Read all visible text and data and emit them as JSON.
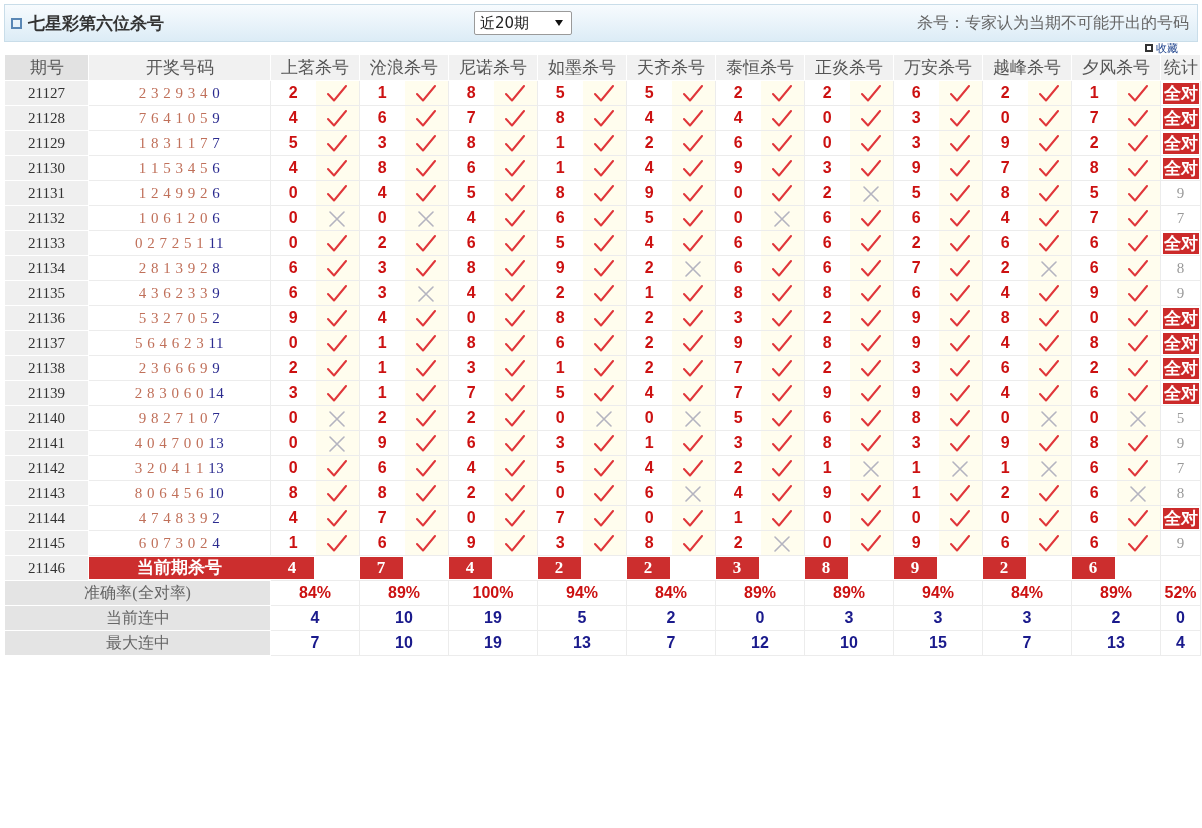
{
  "title": "七星彩第六位杀号",
  "period_select": {
    "value": "近20期"
  },
  "hint": "杀号：专家认为当期不可能开出的号码",
  "favorite": {
    "label": "收藏"
  },
  "columns": [
    "期号",
    "开奖号码",
    "上茗杀号",
    "沧浪杀号",
    "尼诺杀号",
    "如墨杀号",
    "天齐杀号",
    "泰恒杀号",
    "正炎杀号",
    "万安杀号",
    "越峰杀号",
    "夕风杀号",
    "统计"
  ],
  "rows": [
    {
      "issue": "21127",
      "main": "2 3 2 9 3 4",
      "special": "0",
      "kills": [
        {
          "num": "2",
          "hit": true
        },
        {
          "num": "1",
          "hit": true
        },
        {
          "num": "8",
          "hit": true
        },
        {
          "num": "5",
          "hit": true
        },
        {
          "num": "5",
          "hit": true
        },
        {
          "num": "2",
          "hit": true
        },
        {
          "num": "2",
          "hit": true
        },
        {
          "num": "6",
          "hit": true
        },
        {
          "num": "2",
          "hit": true
        },
        {
          "num": "1",
          "hit": true
        }
      ],
      "stat": {
        "kind": "badge",
        "text": "全对"
      }
    },
    {
      "issue": "21128",
      "main": "7 6 4 1 0 5",
      "special": "9",
      "kills": [
        {
          "num": "4",
          "hit": true
        },
        {
          "num": "6",
          "hit": true
        },
        {
          "num": "7",
          "hit": true
        },
        {
          "num": "8",
          "hit": true
        },
        {
          "num": "4",
          "hit": true
        },
        {
          "num": "4",
          "hit": true
        },
        {
          "num": "0",
          "hit": true
        },
        {
          "num": "3",
          "hit": true
        },
        {
          "num": "0",
          "hit": true
        },
        {
          "num": "7",
          "hit": true
        }
      ],
      "stat": {
        "kind": "badge",
        "text": "全对"
      }
    },
    {
      "issue": "21129",
      "main": "1 8 3 1 1 7",
      "special": "7",
      "kills": [
        {
          "num": "5",
          "hit": true
        },
        {
          "num": "3",
          "hit": true
        },
        {
          "num": "8",
          "hit": true
        },
        {
          "num": "1",
          "hit": true
        },
        {
          "num": "2",
          "hit": true
        },
        {
          "num": "6",
          "hit": true
        },
        {
          "num": "0",
          "hit": true
        },
        {
          "num": "3",
          "hit": true
        },
        {
          "num": "9",
          "hit": true
        },
        {
          "num": "2",
          "hit": true
        }
      ],
      "stat": {
        "kind": "badge",
        "text": "全对"
      }
    },
    {
      "issue": "21130",
      "main": "1 1 5 3 4 5",
      "special": "6",
      "kills": [
        {
          "num": "4",
          "hit": true
        },
        {
          "num": "8",
          "hit": true
        },
        {
          "num": "6",
          "hit": true
        },
        {
          "num": "1",
          "hit": true
        },
        {
          "num": "4",
          "hit": true
        },
        {
          "num": "9",
          "hit": true
        },
        {
          "num": "3",
          "hit": true
        },
        {
          "num": "9",
          "hit": true
        },
        {
          "num": "7",
          "hit": true
        },
        {
          "num": "8",
          "hit": true
        }
      ],
      "stat": {
        "kind": "badge",
        "text": "全对"
      }
    },
    {
      "issue": "21131",
      "main": "1 2 4 9 9 2",
      "special": "6",
      "kills": [
        {
          "num": "0",
          "hit": true
        },
        {
          "num": "4",
          "hit": true
        },
        {
          "num": "5",
          "hit": true
        },
        {
          "num": "8",
          "hit": true
        },
        {
          "num": "9",
          "hit": true
        },
        {
          "num": "0",
          "hit": true
        },
        {
          "num": "2",
          "hit": false
        },
        {
          "num": "5",
          "hit": true
        },
        {
          "num": "8",
          "hit": true
        },
        {
          "num": "5",
          "hit": true
        }
      ],
      "stat": {
        "kind": "count",
        "text": "9"
      }
    },
    {
      "issue": "21132",
      "main": "1 0 6 1 2 0",
      "special": "6",
      "kills": [
        {
          "num": "0",
          "hit": false
        },
        {
          "num": "0",
          "hit": false
        },
        {
          "num": "4",
          "hit": true
        },
        {
          "num": "6",
          "hit": true
        },
        {
          "num": "5",
          "hit": true
        },
        {
          "num": "0",
          "hit": false
        },
        {
          "num": "6",
          "hit": true
        },
        {
          "num": "6",
          "hit": true
        },
        {
          "num": "4",
          "hit": true
        },
        {
          "num": "7",
          "hit": true
        }
      ],
      "stat": {
        "kind": "count",
        "text": "7"
      }
    },
    {
      "issue": "21133",
      "main": "0 2 7 2 5 1",
      "special": "11",
      "kills": [
        {
          "num": "0",
          "hit": true
        },
        {
          "num": "2",
          "hit": true
        },
        {
          "num": "6",
          "hit": true
        },
        {
          "num": "5",
          "hit": true
        },
        {
          "num": "4",
          "hit": true
        },
        {
          "num": "6",
          "hit": true
        },
        {
          "num": "6",
          "hit": true
        },
        {
          "num": "2",
          "hit": true
        },
        {
          "num": "6",
          "hit": true
        },
        {
          "num": "6",
          "hit": true
        }
      ],
      "stat": {
        "kind": "badge",
        "text": "全对"
      }
    },
    {
      "issue": "21134",
      "main": "2 8 1 3 9 2",
      "special": "8",
      "kills": [
        {
          "num": "6",
          "hit": true
        },
        {
          "num": "3",
          "hit": true
        },
        {
          "num": "8",
          "hit": true
        },
        {
          "num": "9",
          "hit": true
        },
        {
          "num": "2",
          "hit": false
        },
        {
          "num": "6",
          "hit": true
        },
        {
          "num": "6",
          "hit": true
        },
        {
          "num": "7",
          "hit": true
        },
        {
          "num": "2",
          "hit": false
        },
        {
          "num": "6",
          "hit": true
        }
      ],
      "stat": {
        "kind": "count",
        "text": "8"
      }
    },
    {
      "issue": "21135",
      "main": "4 3 6 2 3 3",
      "special": "9",
      "kills": [
        {
          "num": "6",
          "hit": true
        },
        {
          "num": "3",
          "hit": false
        },
        {
          "num": "4",
          "hit": true
        },
        {
          "num": "2",
          "hit": true
        },
        {
          "num": "1",
          "hit": true
        },
        {
          "num": "8",
          "hit": true
        },
        {
          "num": "8",
          "hit": true
        },
        {
          "num": "6",
          "hit": true
        },
        {
          "num": "4",
          "hit": true
        },
        {
          "num": "9",
          "hit": true
        }
      ],
      "stat": {
        "kind": "count",
        "text": "9"
      }
    },
    {
      "issue": "21136",
      "main": "5 3 2 7 0 5",
      "special": "2",
      "kills": [
        {
          "num": "9",
          "hit": true
        },
        {
          "num": "4",
          "hit": true
        },
        {
          "num": "0",
          "hit": true
        },
        {
          "num": "8",
          "hit": true
        },
        {
          "num": "2",
          "hit": true
        },
        {
          "num": "3",
          "hit": true
        },
        {
          "num": "2",
          "hit": true
        },
        {
          "num": "9",
          "hit": true
        },
        {
          "num": "8",
          "hit": true
        },
        {
          "num": "0",
          "hit": true
        }
      ],
      "stat": {
        "kind": "badge",
        "text": "全对"
      }
    },
    {
      "issue": "21137",
      "main": "5 6 4 6 2 3",
      "special": "11",
      "kills": [
        {
          "num": "0",
          "hit": true
        },
        {
          "num": "1",
          "hit": true
        },
        {
          "num": "8",
          "hit": true
        },
        {
          "num": "6",
          "hit": true
        },
        {
          "num": "2",
          "hit": true
        },
        {
          "num": "9",
          "hit": true
        },
        {
          "num": "8",
          "hit": true
        },
        {
          "num": "9",
          "hit": true
        },
        {
          "num": "4",
          "hit": true
        },
        {
          "num": "8",
          "hit": true
        }
      ],
      "stat": {
        "kind": "badge",
        "text": "全对"
      }
    },
    {
      "issue": "21138",
      "main": "2 3 6 6 6 9",
      "special": "9",
      "kills": [
        {
          "num": "2",
          "hit": true
        },
        {
          "num": "1",
          "hit": true
        },
        {
          "num": "3",
          "hit": true
        },
        {
          "num": "1",
          "hit": true
        },
        {
          "num": "2",
          "hit": true
        },
        {
          "num": "7",
          "hit": true
        },
        {
          "num": "2",
          "hit": true
        },
        {
          "num": "3",
          "hit": true
        },
        {
          "num": "6",
          "hit": true
        },
        {
          "num": "2",
          "hit": true
        }
      ],
      "stat": {
        "kind": "badge",
        "text": "全对"
      }
    },
    {
      "issue": "21139",
      "main": "2 8 3 0 6 0",
      "special": "14",
      "kills": [
        {
          "num": "3",
          "hit": true
        },
        {
          "num": "1",
          "hit": true
        },
        {
          "num": "7",
          "hit": true
        },
        {
          "num": "5",
          "hit": true
        },
        {
          "num": "4",
          "hit": true
        },
        {
          "num": "7",
          "hit": true
        },
        {
          "num": "9",
          "hit": true
        },
        {
          "num": "9",
          "hit": true
        },
        {
          "num": "4",
          "hit": true
        },
        {
          "num": "6",
          "hit": true
        }
      ],
      "stat": {
        "kind": "badge",
        "text": "全对"
      }
    },
    {
      "issue": "21140",
      "main": "9 8 2 7 1 0",
      "special": "7",
      "kills": [
        {
          "num": "0",
          "hit": false
        },
        {
          "num": "2",
          "hit": true
        },
        {
          "num": "2",
          "hit": true
        },
        {
          "num": "0",
          "hit": false
        },
        {
          "num": "0",
          "hit": false
        },
        {
          "num": "5",
          "hit": true
        },
        {
          "num": "6",
          "hit": true
        },
        {
          "num": "8",
          "hit": true
        },
        {
          "num": "0",
          "hit": false
        },
        {
          "num": "0",
          "hit": false
        }
      ],
      "stat": {
        "kind": "count",
        "text": "5"
      }
    },
    {
      "issue": "21141",
      "main": "4 0 4 7 0 0",
      "special": "13",
      "kills": [
        {
          "num": "0",
          "hit": false
        },
        {
          "num": "9",
          "hit": true
        },
        {
          "num": "6",
          "hit": true
        },
        {
          "num": "3",
          "hit": true
        },
        {
          "num": "1",
          "hit": true
        },
        {
          "num": "3",
          "hit": true
        },
        {
          "num": "8",
          "hit": true
        },
        {
          "num": "3",
          "hit": true
        },
        {
          "num": "9",
          "hit": true
        },
        {
          "num": "8",
          "hit": true
        }
      ],
      "stat": {
        "kind": "count",
        "text": "9"
      }
    },
    {
      "issue": "21142",
      "main": "3 2 0 4 1 1",
      "special": "13",
      "kills": [
        {
          "num": "0",
          "hit": true
        },
        {
          "num": "6",
          "hit": true
        },
        {
          "num": "4",
          "hit": true
        },
        {
          "num": "5",
          "hit": true
        },
        {
          "num": "4",
          "hit": true
        },
        {
          "num": "2",
          "hit": true
        },
        {
          "num": "1",
          "hit": false
        },
        {
          "num": "1",
          "hit": false
        },
        {
          "num": "1",
          "hit": false
        },
        {
          "num": "6",
          "hit": true
        }
      ],
      "stat": {
        "kind": "count",
        "text": "7"
      }
    },
    {
      "issue": "21143",
      "main": "8 0 6 4 5 6",
      "special": "10",
      "kills": [
        {
          "num": "8",
          "hit": true
        },
        {
          "num": "8",
          "hit": true
        },
        {
          "num": "2",
          "hit": true
        },
        {
          "num": "0",
          "hit": true
        },
        {
          "num": "6",
          "hit": false
        },
        {
          "num": "4",
          "hit": true
        },
        {
          "num": "9",
          "hit": true
        },
        {
          "num": "1",
          "hit": true
        },
        {
          "num": "2",
          "hit": true
        },
        {
          "num": "6",
          "hit": false
        }
      ],
      "stat": {
        "kind": "count",
        "text": "8"
      }
    },
    {
      "issue": "21144",
      "main": "4 7 4 8 3 9",
      "special": "2",
      "kills": [
        {
          "num": "4",
          "hit": true
        },
        {
          "num": "7",
          "hit": true
        },
        {
          "num": "0",
          "hit": true
        },
        {
          "num": "7",
          "hit": true
        },
        {
          "num": "0",
          "hit": true
        },
        {
          "num": "1",
          "hit": true
        },
        {
          "num": "0",
          "hit": true
        },
        {
          "num": "0",
          "hit": true
        },
        {
          "num": "0",
          "hit": true
        },
        {
          "num": "6",
          "hit": true
        }
      ],
      "stat": {
        "kind": "badge",
        "text": "全对"
      }
    },
    {
      "issue": "21145",
      "main": "6 0 7 3 0 2",
      "special": "4",
      "kills": [
        {
          "num": "1",
          "hit": true
        },
        {
          "num": "6",
          "hit": true
        },
        {
          "num": "9",
          "hit": true
        },
        {
          "num": "3",
          "hit": true
        },
        {
          "num": "8",
          "hit": true
        },
        {
          "num": "2",
          "hit": false
        },
        {
          "num": "0",
          "hit": true
        },
        {
          "num": "9",
          "hit": true
        },
        {
          "num": "6",
          "hit": true
        },
        {
          "num": "6",
          "hit": true
        }
      ],
      "stat": {
        "kind": "count",
        "text": "9"
      }
    }
  ],
  "current": {
    "issue": "21146",
    "label": "当前期杀号",
    "picks": [
      "4",
      "7",
      "4",
      "2",
      "2",
      "3",
      "8",
      "9",
      "2",
      "6"
    ]
  },
  "summary": [
    {
      "kind": "rate",
      "label": "准确率(全对率)",
      "values": [
        "84%",
        "89%",
        "100%",
        "94%",
        "84%",
        "89%",
        "89%",
        "94%",
        "84%",
        "89%",
        "52%"
      ]
    },
    {
      "kind": "streak",
      "label": "当前连中",
      "values": [
        "4",
        "10",
        "19",
        "5",
        "2",
        "0",
        "3",
        "3",
        "3",
        "2",
        "0"
      ]
    },
    {
      "kind": "streak",
      "label": "最大连中",
      "values": [
        "7",
        "10",
        "19",
        "13",
        "7",
        "12",
        "10",
        "15",
        "7",
        "13",
        "4"
      ]
    }
  ]
}
